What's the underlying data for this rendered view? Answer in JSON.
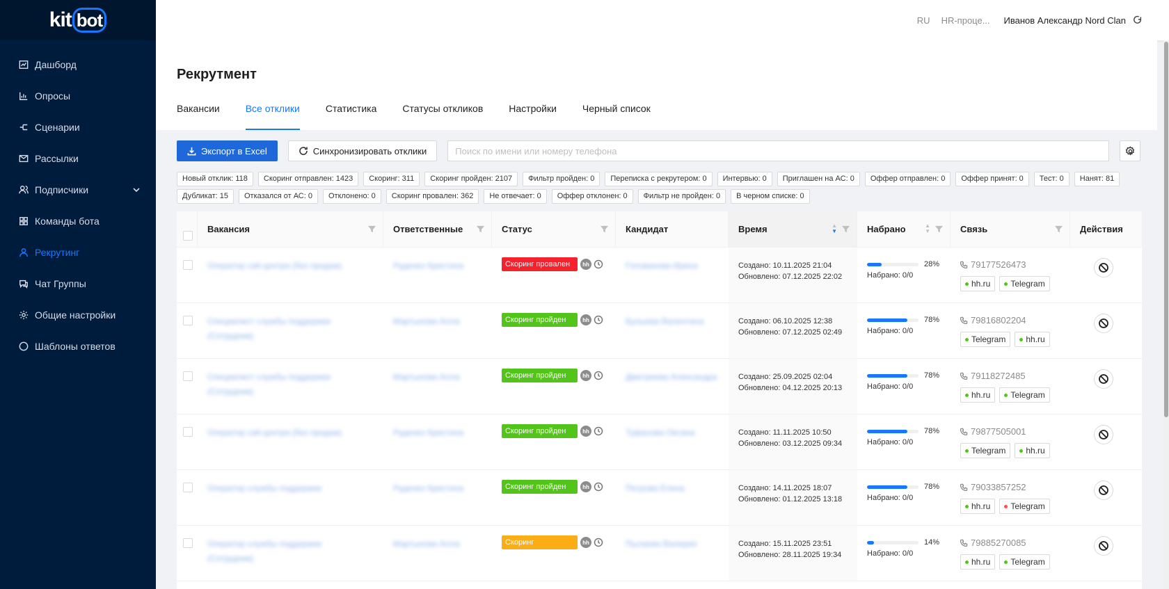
{
  "app": {
    "logo_main": "kit",
    "logo_accent": "bot"
  },
  "sidebar": {
    "items": [
      {
        "label": "Дашборд",
        "icon": "chart-icon"
      },
      {
        "label": "Опросы",
        "icon": "bar-chart-icon"
      },
      {
        "label": "Сценарии",
        "icon": "flow-icon"
      },
      {
        "label": "Рассылки",
        "icon": "mail-icon"
      },
      {
        "label": "Подписчики",
        "icon": "users-icon"
      },
      {
        "label": "Команды бота",
        "icon": "grid-icon"
      },
      {
        "label": "Рекрутинг",
        "icon": "user-icon"
      },
      {
        "label": "Чат Группы",
        "icon": "chat-icon"
      },
      {
        "label": "Общие настройки",
        "icon": "gear-icon"
      },
      {
        "label": "Шаблоны ответов",
        "icon": "message-icon"
      }
    ]
  },
  "header": {
    "lang": "RU",
    "process": "HR-проце...",
    "user": "Иванов Александр Nord Clan"
  },
  "page": {
    "title": "Рекрутмент",
    "tabs": [
      "Вакансии",
      "Все отклики",
      "Статистика",
      "Статусы откликов",
      "Настройки",
      "Черный список"
    ]
  },
  "toolbar": {
    "export_label": "Экспорт в Excel",
    "sync_label": "Синхронизировать отклики",
    "search_placeholder": "Поиск по имени или номеру телефона"
  },
  "chips": {
    "row1": [
      "Новый отклик: 118",
      "Скоринг отправлен: 1423",
      "Скоринг: 311",
      "Скоринг пройден: 2107",
      "Фильтр пройден: 0",
      "Переписка с рекрутером: 0",
      "Интервью: 0",
      "Приглашен на АС: 0",
      "Оффер отправлен: 0",
      "Оффер принят: 0",
      "Тест: 0",
      "Нанят: 81"
    ],
    "row2": [
      "Дубликат: 15",
      "Отказался от АС: 0",
      "Отклонено: 0",
      "Скоринг провален: 362",
      "Не отвечает: 0",
      "Оффер отклонен: 0",
      "Фильтр не пройден: 0",
      "В черном списке: 0"
    ]
  },
  "table": {
    "columns": [
      "Вакансия",
      "Ответственные",
      "Статус",
      "Кандидат",
      "Время",
      "Набрано",
      "Связь",
      "Действия"
    ],
    "hh_label": "hh",
    "rows": [
      {
        "vacancy": "Оператор call-центра (без продаж)",
        "responsible": "Руденко Кристина",
        "status": "Скоринг провален",
        "status_color": "#f5222d",
        "candidate": "Голованова Ирина",
        "created": "Создано: 10.11.2025 21:04",
        "updated": "Обновлено: 07.12.2025 22:02",
        "progress": 28,
        "progress_label": "28%",
        "collected": "Набрано: 0/0",
        "phone": "79177526473",
        "links": [
          {
            "label": "hh.ru",
            "dot": "green"
          },
          {
            "label": "Telegram",
            "dot": "green"
          }
        ]
      },
      {
        "vacancy": "Специалист службы поддержки (Сотрудник)",
        "responsible": "Мартынова Алла",
        "status": "Скоринг пройден",
        "status_color": "#52c41a",
        "candidate": "Булыева Валентина",
        "created": "Создано: 06.10.2025 12:38",
        "updated": "Обновлено: 07.12.2025 02:49",
        "progress": 78,
        "progress_label": "78%",
        "collected": "Набрано: 0/0",
        "phone": "79816802204",
        "links": [
          {
            "label": "Telegram",
            "dot": "green"
          },
          {
            "label": "hh.ru",
            "dot": "green"
          }
        ]
      },
      {
        "vacancy": "Специалист службы поддержки (Сотрудник)",
        "responsible": "Мартынова Алла",
        "status": "Скоринг пройден",
        "status_color": "#52c41a",
        "candidate": "Дмитриева Александра",
        "created": "Создано: 25.09.2025 02:04",
        "updated": "Обновлено: 04.12.2025 20:13",
        "progress": 78,
        "progress_label": "78%",
        "collected": "Набрано: 0/0",
        "phone": "79118272485",
        "links": [
          {
            "label": "hh.ru",
            "dot": "green"
          },
          {
            "label": "Telegram",
            "dot": "green"
          }
        ]
      },
      {
        "vacancy": "Оператор call-центра (без продаж)",
        "responsible": "Руденко Кристина",
        "status": "Скоринг пройден",
        "status_color": "#52c41a",
        "candidate": "Туфанова Оксана",
        "created": "Создано: 11.11.2025 10:50",
        "updated": "Обновлено: 03.12.2025 09:34",
        "progress": 78,
        "progress_label": "78%",
        "collected": "Набрано: 0/0",
        "phone": "79877505001",
        "links": [
          {
            "label": "Telegram",
            "dot": "green"
          },
          {
            "label": "hh.ru",
            "dot": "green"
          }
        ]
      },
      {
        "vacancy": "Оператор службы поддержки",
        "responsible": "Руденко Кристина",
        "status": "Скоринг пройден",
        "status_color": "#52c41a",
        "candidate": "Петрова Елена",
        "created": "Создано: 14.11.2025 18:07",
        "updated": "Обновлено: 01.12.2025 13:18",
        "progress": 78,
        "progress_label": "78%",
        "collected": "Набрано: 0/0",
        "phone": "79033857252",
        "links": [
          {
            "label": "hh.ru",
            "dot": "green"
          },
          {
            "label": "Telegram",
            "dot": "red"
          }
        ]
      },
      {
        "vacancy": "Оператор службы поддержки (Сотрудник)",
        "responsible": "Мартынова Алла",
        "status": "Скоринг",
        "status_color": "#faad14",
        "candidate": "Пылаева Валерия",
        "created": "Создано: 15.11.2025 23:51",
        "updated": "Обновлено: 28.11.2025 19:34",
        "progress": 14,
        "progress_label": "14%",
        "collected": "Набрано: 0/0",
        "phone": "79885270085",
        "links": [
          {
            "label": "hh.ru",
            "dot": "green"
          },
          {
            "label": "Telegram",
            "dot": "green"
          }
        ]
      }
    ]
  },
  "colors": {
    "sidebar_bg": "#001c3d",
    "accent": "#1677ff",
    "primary_button": "#1f68d9"
  }
}
